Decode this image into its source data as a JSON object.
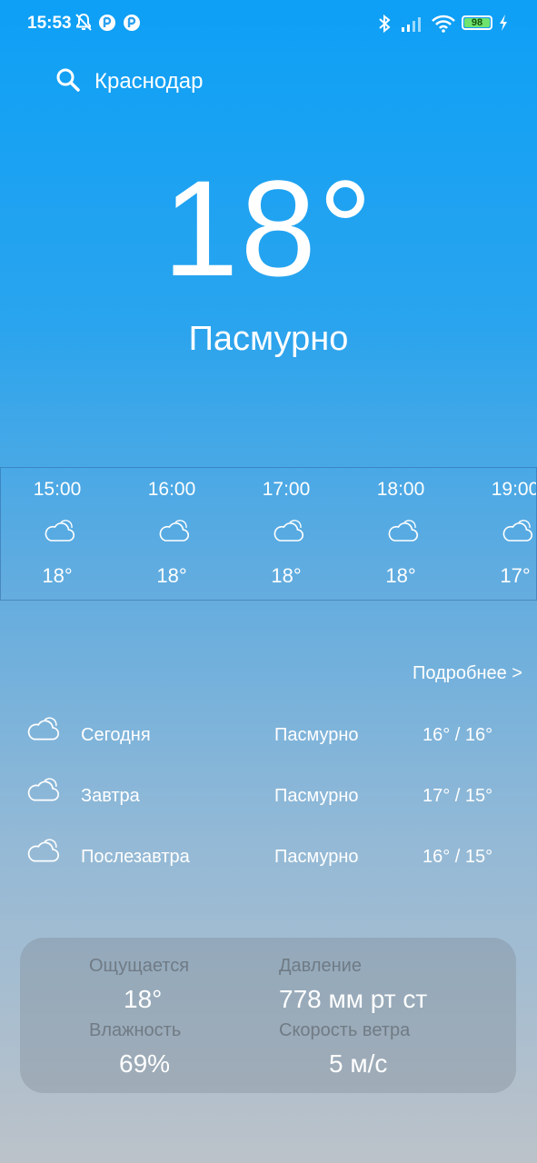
{
  "status_bar": {
    "time": "15:53",
    "battery": "98"
  },
  "search": {
    "city": "Краснодар"
  },
  "current": {
    "temp": "18°",
    "condition": "Пасмурно"
  },
  "hourly": [
    {
      "time": "15:00",
      "temp": "18°",
      "icon": "cloud-icon"
    },
    {
      "time": "16:00",
      "temp": "18°",
      "icon": "cloud-icon"
    },
    {
      "time": "17:00",
      "temp": "18°",
      "icon": "cloud-icon"
    },
    {
      "time": "18:00",
      "temp": "18°",
      "icon": "cloud-icon"
    },
    {
      "time": "19:00",
      "temp": "17°",
      "icon": "cloud-icon"
    }
  ],
  "more_link": "Подробнее >",
  "daily": [
    {
      "day": "Сегодня",
      "condition": "Пасмурно",
      "range": "16° / 16°",
      "icon": "cloud-icon"
    },
    {
      "day": "Завтра",
      "condition": "Пасмурно",
      "range": "17° / 15°",
      "icon": "cloud-icon"
    },
    {
      "day": "Послезавтра",
      "condition": "Пасмурно",
      "range": "16° / 15°",
      "icon": "cloud-icon"
    }
  ],
  "details": {
    "feels_label": "Ощущается",
    "feels_value": "18°",
    "pressure_label": "Давление",
    "pressure_value": "778 мм рт ст",
    "humidity_label": "Влажность",
    "humidity_value": "69%",
    "wind_label": "Скорость ветра",
    "wind_value": "5 м/с"
  }
}
